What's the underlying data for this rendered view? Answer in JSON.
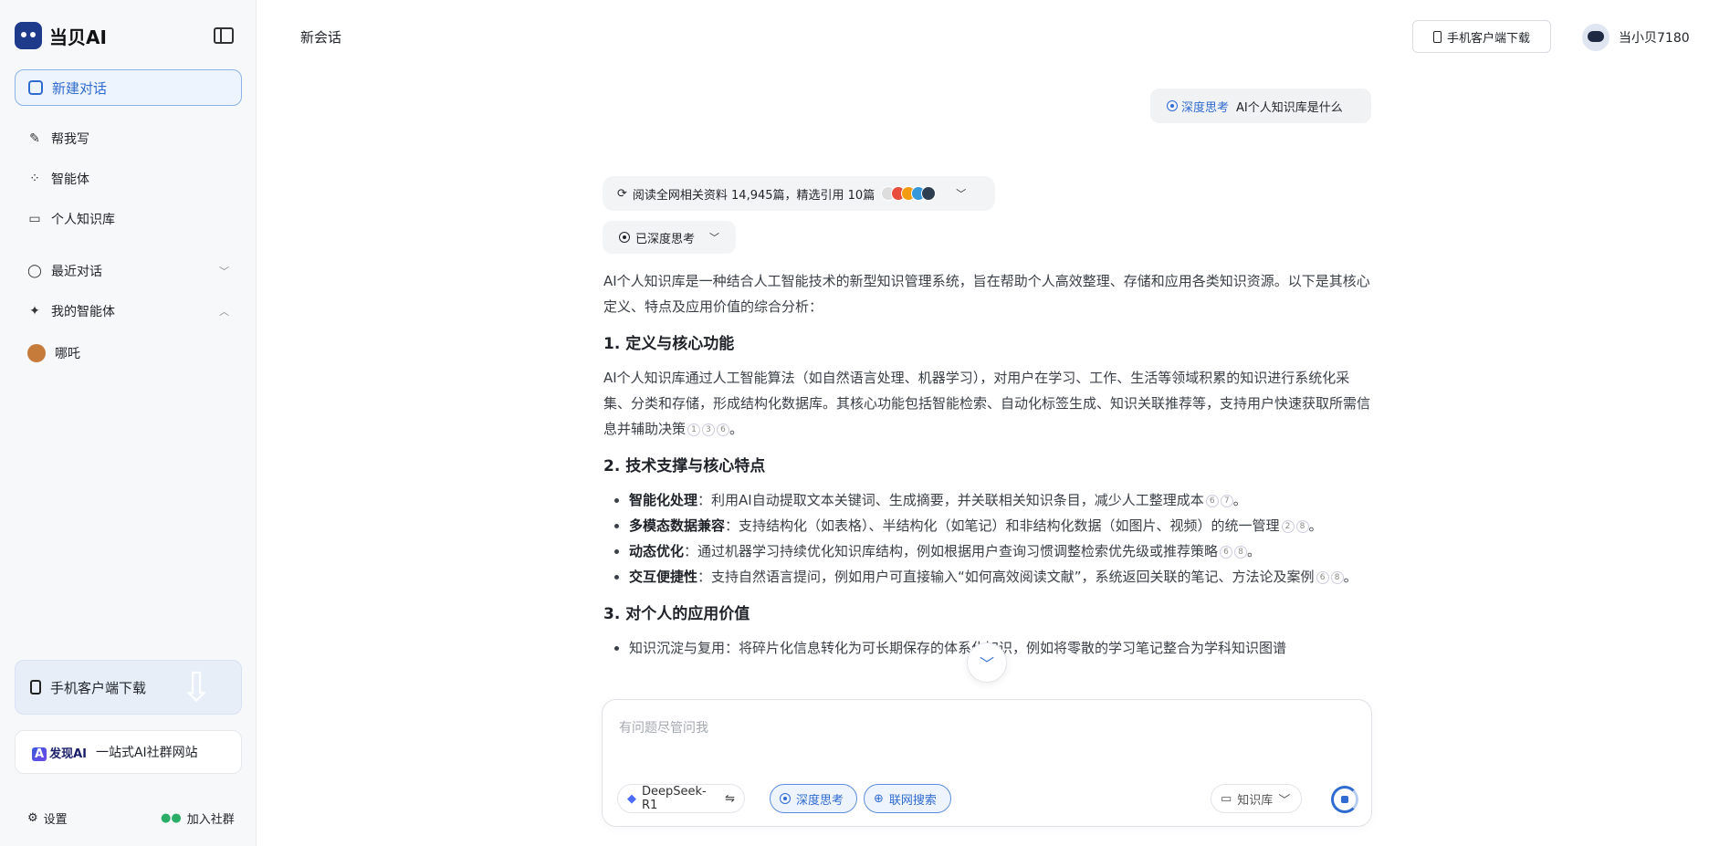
{
  "sidebar": {
    "logo": "当贝AI",
    "new_chat": "新建对话",
    "nav": [
      {
        "label": "帮我写"
      },
      {
        "label": "智能体"
      },
      {
        "label": "个人知识库"
      }
    ],
    "recent": "最近对话",
    "my_agents": "我的智能体",
    "agent_name": "哪吒",
    "promo": "手机客户端下载",
    "site_brand": "发现AI",
    "site_text": "一站式AI社群网站",
    "settings": "设置",
    "join": "加入社群"
  },
  "header": {
    "title": "新会话",
    "download": "手机客户端下载",
    "username": "当小贝7180"
  },
  "chat": {
    "user_tag": "深度思考",
    "user_question": "AI个人知识库是什么",
    "read_info": "阅读全网相关资料 14,945篇，精选引用 10篇",
    "thought": "已深度思考",
    "intro": "AI个人知识库是一种结合人工智能技术的新型知识管理系统，旨在帮助个人高效整理、存储和应用各类知识资源。以下是其核心定义、特点及应用价值的综合分析：",
    "h1": "1. 定义与核心功能",
    "p1": "AI个人知识库通过人工智能算法（如自然语言处理、机器学习），对用户在学习、工作、生活等领域积累的知识进行系统化采集、分类和存储，形成结构化数据库。其核心功能包括智能检索、自动化标签生成、知识关联推荐等，支持用户快速获取所需信息并辅助决策",
    "h2": "2. 技术支撑与核心特点",
    "bullets": [
      {
        "title": "智能化处理",
        "text": "：利用AI自动提取文本关键词、生成摘要，并关联相关知识条目，减少人工整理成本",
        "cites": [
          "6",
          "7"
        ]
      },
      {
        "title": "多模态数据兼容",
        "text": "：支持结构化（如表格）、半结构化（如笔记）和非结构化数据（如图片、视频）的统一管理",
        "cites": [
          "2",
          "8"
        ]
      },
      {
        "title": "动态优化",
        "text": "：通过机器学习持续优化知识库结构，例如根据用户查询习惯调整检索优先级或推荐策略",
        "cites": [
          "6",
          "8"
        ]
      },
      {
        "title": "交互便捷性",
        "text": "：支持自然语言提问，例如用户可直接输入“如何高效阅读文献”，系统返回关联的笔记、方法论及案例",
        "cites": [
          "6",
          "8"
        ]
      }
    ],
    "p1_cites": [
      "1",
      "3",
      "6"
    ],
    "h3": "3. 对个人的应用价值",
    "partial": "知识沉淀与复用：将碎片化信息转化为可长期保存的体系化知识，例如将零散的学习笔记整合为学科知识图谱"
  },
  "input": {
    "placeholder": "有问题尽管问我",
    "model": "DeepSeek-R1",
    "think": "深度思考",
    "web": "联网搜索",
    "kb": "知识库"
  },
  "colors": {
    "accent": "#2f6bd1",
    "sidebar_bg": "#f7f8fa"
  }
}
